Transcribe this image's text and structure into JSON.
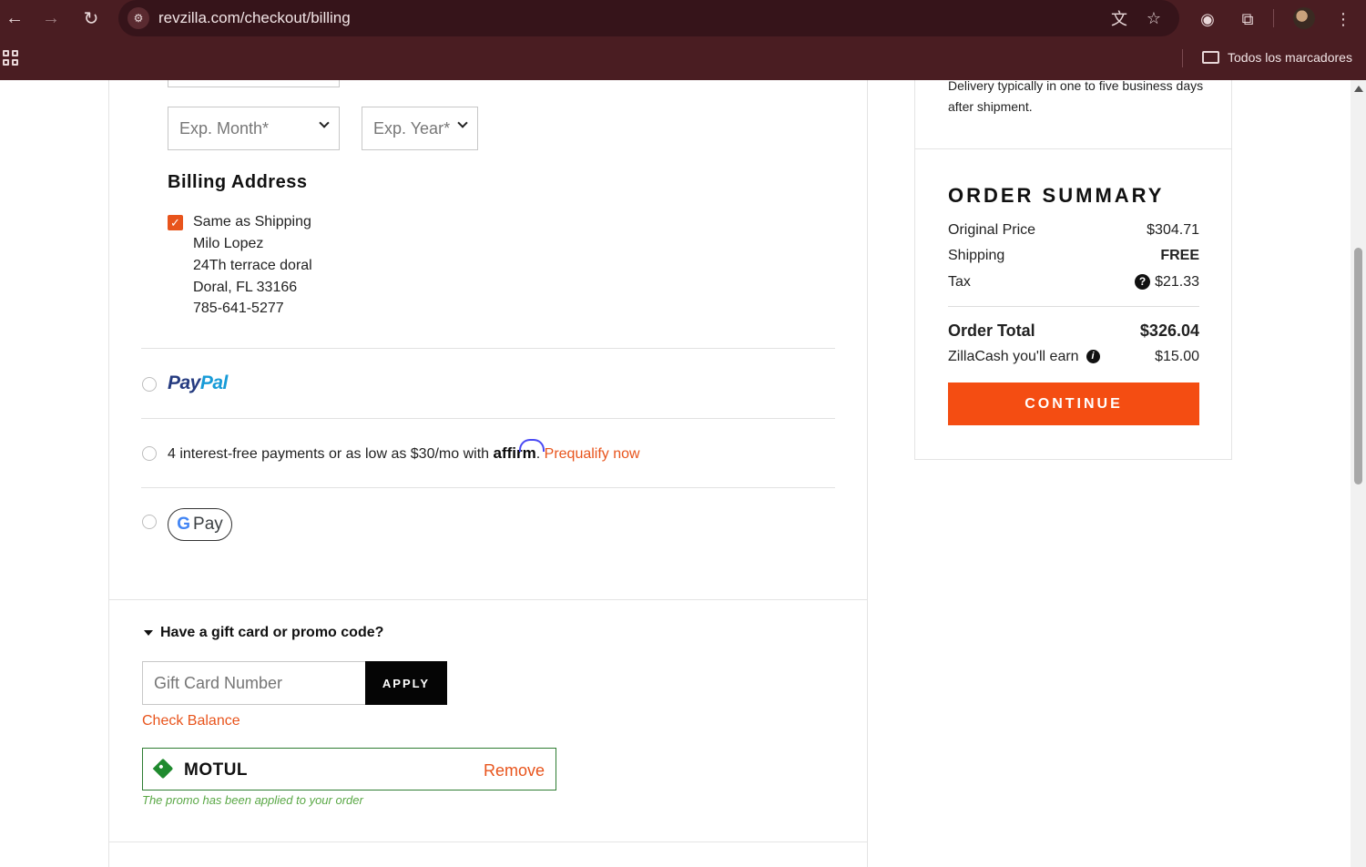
{
  "browser": {
    "url": "revzilla.com/checkout/billing",
    "bookmarks_label": "Todos los marcadores",
    "icons": [
      "back-arrow-icon",
      "forward-arrow-icon",
      "reload-icon",
      "site-settings-icon",
      "translate-icon",
      "star-icon",
      "extension-icon",
      "puzzle-icon",
      "menu-dots-icon",
      "apps-grid-icon",
      "folder-icon"
    ]
  },
  "card": {
    "exp_month_placeholder": "Exp. Month*",
    "exp_year_placeholder": "Exp. Year*"
  },
  "billing": {
    "heading": "Billing Address",
    "same_as_shipping": "Same as Shipping",
    "name": "Milo Lopez",
    "street": "24Th terrace doral",
    "city_line": "Doral, FL 33166",
    "phone": "785-641-5277"
  },
  "payment_options": {
    "paypal_pay": "Pay",
    "paypal_pal": "Pal",
    "affirm_text": "4 interest-free payments or as low as $30/mo with",
    "affirm_logo": "affirm",
    "affirm_period": ".",
    "affirm_link": "Prequalify now",
    "gpay_g": "G",
    "gpay_text": "Pay"
  },
  "gift": {
    "toggle_label": "Have a gift card or promo code?",
    "input_placeholder": "Gift Card Number",
    "apply_label": "APPLY",
    "check_balance": "Check Balance",
    "promo_code": "MOTUL",
    "remove_label": "Remove",
    "promo_message": "The promo has been applied to your order"
  },
  "delivery_note": "Delivery typically in one to five business days after shipment.",
  "summary": {
    "title": "ORDER SUMMARY",
    "original_price_label": "Original Price",
    "original_price": "$304.71",
    "shipping_label": "Shipping",
    "shipping_value": "FREE",
    "tax_label": "Tax",
    "tax_value": "$21.33",
    "total_label": "Order Total",
    "total_value": "$326.04",
    "zillacash_label": "ZillaCash you'll earn",
    "zillacash_value": "$15.00",
    "continue_label": "CONTINUE"
  },
  "colors": {
    "chrome": "#4a1d22",
    "accent_orange": "#f44d12",
    "promo_green": "#2e7d32"
  }
}
